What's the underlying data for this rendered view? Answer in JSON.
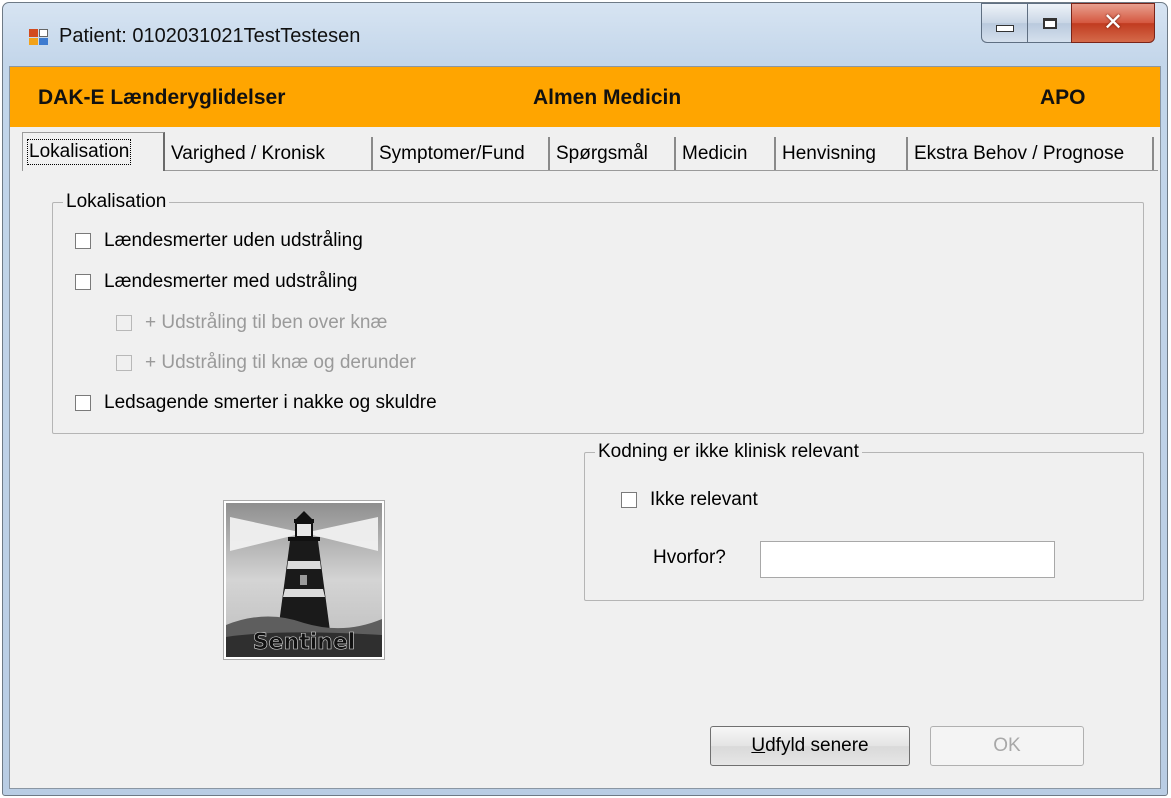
{
  "window": {
    "title": "Patient: 0102031021TestTestesen"
  },
  "banner": {
    "left": "DAK-E Lænderyglidelser",
    "center": "Almen Medicin",
    "right": "APO"
  },
  "tabs": [
    {
      "label": "Lokalisation",
      "active": true
    },
    {
      "label": "Varighed / Kronisk"
    },
    {
      "label": "Symptomer/Fund"
    },
    {
      "label": "Spørgsmål"
    },
    {
      "label": "Medicin"
    },
    {
      "label": "Henvisning"
    },
    {
      "label": "Ekstra Behov / Prognose"
    }
  ],
  "lokalisation": {
    "legend": "Lokalisation",
    "items": [
      {
        "label": "Lændesmerter uden udstråling",
        "checked": false,
        "enabled": true
      },
      {
        "label": "Lændesmerter med udstråling",
        "checked": false,
        "enabled": true
      },
      {
        "label": "+ Udstråling til ben over knæ",
        "checked": false,
        "enabled": false
      },
      {
        "label": "+ Udstråling til knæ og derunder",
        "checked": false,
        "enabled": false
      },
      {
        "label": "Ledsagende smerter i nakke og skuldre",
        "checked": false,
        "enabled": true
      }
    ]
  },
  "kodning": {
    "legend": "Kodning er ikke klinisk relevant",
    "ikke_relevant_label": "Ikke relevant",
    "hvorfor_label": "Hvorfor?",
    "hvorfor_value": ""
  },
  "logo": {
    "text": "Sentinel"
  },
  "buttons": {
    "udfyld_prefix": "U",
    "udfyld_rest": "dfyld senere",
    "ok": "OK"
  },
  "colors": {
    "banner": "#ffa500",
    "client": "#f0f0f0",
    "close_button": "#c13b20"
  }
}
